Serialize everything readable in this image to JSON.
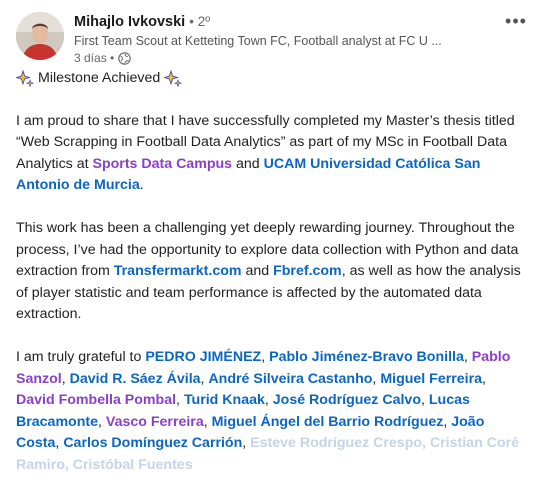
{
  "author": {
    "name": "Mihajlo Ivkovski",
    "degree": "• 2º",
    "headline": "First Team Scout at Ketteting Town FC, Football analyst at FC U ...",
    "time": "3 días •"
  },
  "post": {
    "milestone": "Milestone Achieved",
    "p1_a": "I am proud to share that I have successfully completed my Master’s thesis titled “Web Scrapping in Football Data Analytics” as part of my MSc in Football Data Analytics at ",
    "p1_org": "Sports Data Campus",
    "p1_and": " and ",
    "p1_uni": "UCAM Universidad Católica San Antonio de Murcia",
    "p1_end": ".",
    "p2_a": "This work has been a challenging yet deeply rewarding journey. Throughout the process, I’ve had the opportunity to explore data collection with Python and data extraction from ",
    "p2_link1": "Transfermarkt.com",
    "p2_and": " and ",
    "p2_link2": "Fbref.com",
    "p2_end": ", as well as how the analysis of player statistic and team performance is affected by the automated data extraction.",
    "p3_a": "I am truly grateful to ",
    "mentions": [
      {
        "name": "PEDRO JIMÉNEZ",
        "color": "blue"
      },
      {
        "name": "Pablo Jiménez-Bravo Bonilla",
        "color": "blue"
      },
      {
        "name": "Pablo Sanzol",
        "color": "purple"
      },
      {
        "name": "David R. Sáez Ávila",
        "color": "blue"
      },
      {
        "name": "André Silveira Castanho",
        "color": "blue"
      },
      {
        "name": "Miguel Ferreira",
        "color": "blue"
      },
      {
        "name": "David Fombella Pombal",
        "color": "purple"
      },
      {
        "name": "Turid Knaak",
        "color": "blue"
      },
      {
        "name": "José Rodríguez Calvo",
        "color": "blue"
      },
      {
        "name": "Lucas Bracamonte",
        "color": "blue"
      },
      {
        "name": "Vasco Ferreira",
        "color": "purple"
      },
      {
        "name": "Miguel Ángel del Barrio Rodríguez",
        "color": "blue"
      },
      {
        "name": "João Costa",
        "color": "blue"
      },
      {
        "name": "Carlos Domínguez Carrión",
        "color": "blue"
      }
    ],
    "faded_tail": "Esteve Rodríguez Crespo, Cristian Coré Ramiro, Cristóbal Fuentes"
  },
  "colors": {
    "link_blue": "#0a66c2",
    "org_purple": "#8a3fc7",
    "text": "#1f1f1f"
  }
}
